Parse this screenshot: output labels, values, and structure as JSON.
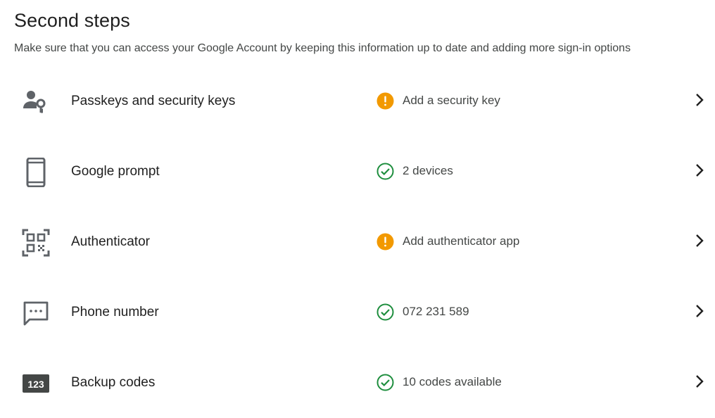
{
  "section": {
    "title": "Second steps",
    "subtitle": "Make sure that you can access your Google Account by keeping this information up to date and adding more sign-in options"
  },
  "colors": {
    "warning": "#f29900",
    "success": "#1e8e3e",
    "icon": "#5f6368",
    "chevron": "#1f1f1f"
  },
  "rows": [
    {
      "label": "Passkeys and security keys",
      "status": "Add a security key",
      "status_type": "warning",
      "icon": "person-key-icon"
    },
    {
      "label": "Google prompt",
      "status": "2 devices",
      "status_type": "success",
      "icon": "phone-icon"
    },
    {
      "label": "Authenticator",
      "status": "Add authenticator app",
      "status_type": "warning",
      "icon": "qr-code-icon"
    },
    {
      "label": "Phone number",
      "status": "072 231 589",
      "status_type": "success",
      "icon": "message-icon"
    },
    {
      "label": "Backup codes",
      "status": "10 codes available",
      "status_type": "success",
      "icon": "backup-codes-icon",
      "icon_text": "123"
    }
  ]
}
